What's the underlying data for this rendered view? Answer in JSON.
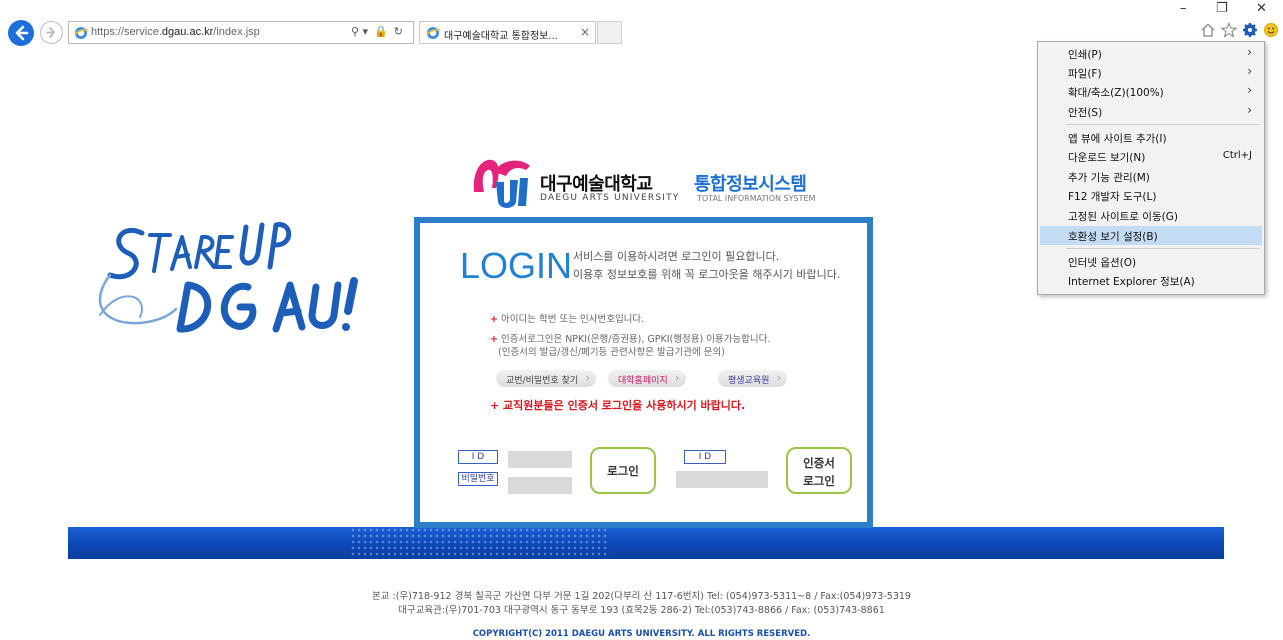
{
  "browser": {
    "url_prefix": "https://service.",
    "url_domain": "dgau.ac.kr",
    "url_path": "/index.jsp",
    "tab_title": "대구예술대학교 통합정보...",
    "tab_close": "×",
    "win_minimize": "–",
    "win_restore": "❐",
    "win_close": "✕",
    "addr_tools": [
      "⚲ ▾",
      "🔒",
      "↻"
    ]
  },
  "header": {
    "univ_kr": "대구예술대학교",
    "system_kr": "통합정보시스템",
    "univ_en": "DAEGU ARTS UNIVERSITY",
    "system_en": "TOTAL INFORMATION SYSTEM"
  },
  "login": {
    "title": "LOGIN",
    "msg1": "서비스를 이용하시려면 로그인이 필요합니다.",
    "msg2": "이용후 정보보호를 위해 꼭 로그아웃을 해주시기 바랍니다.",
    "note_star": "+",
    "note1": "아이디는 학번 또는 인사번호입니다.",
    "note2": "인증서로그인은 NPKI(은행/증권용), GPKI(행정용) 이용가능합니다.",
    "note3": "(인증서의 발급/갱신/폐기등 관련사항은 발급기관에 문의)",
    "link_find": "교번/비밀번호 찾기",
    "link_home": "대학홈페이지",
    "link_lifelong": "평생교육원",
    "faculty_notice": "+ 교직원분들은 인증서 로그인을 사용하시기 바랍니다.",
    "id_label": "I D",
    "pw_label": "비밀번호",
    "login_button": "로그인",
    "cert_id_label": "I D",
    "cert_button_line1": "인증서",
    "cert_button_line2": "로그인",
    "link_colors": {
      "find": "#444444",
      "home": "#c2186b",
      "lifelong": "#3a3aa8"
    }
  },
  "footer": {
    "line1": "본교 :(우)718-912 경북 칠곡군 가산면 다부 거문 1길 202(다부리 산 117-6번지) Tel: (054)973-5311~8 / Fax:(054)973-5319",
    "line2": "대구교육관:(우)701-703 대구광역시 동구 동부로 193 (효목2동 286-2) Tel:(053)743-8866 / Fax: (053)743-8861",
    "copyright": "COPYRIGHT(C) 2011 DAEGU ARTS UNIVERSITY. ALL RIGHTS RESERVED."
  },
  "menu": {
    "items": [
      {
        "label": "인쇄(P)",
        "shortcut": "",
        "arrow": "›"
      },
      {
        "label": "파일(F)",
        "shortcut": "",
        "arrow": "›"
      },
      {
        "label": "확대/축소(Z)(100%)",
        "shortcut": "",
        "arrow": "›"
      },
      {
        "label": "안전(S)",
        "shortcut": "",
        "arrow": "›"
      },
      {
        "label": "앱 뷰에 사이트 추가(I)",
        "shortcut": "",
        "arrow": ""
      },
      {
        "label": "다운로드 보기(N)",
        "shortcut": "Ctrl+J",
        "arrow": ""
      },
      {
        "label": "추가 기능 관리(M)",
        "shortcut": "",
        "arrow": ""
      },
      {
        "label": "F12 개발자 도구(L)",
        "shortcut": "",
        "arrow": ""
      },
      {
        "label": "고정된 사이트로 이동(G)",
        "shortcut": "",
        "arrow": ""
      },
      {
        "label": "호환성 보기 설정(B)",
        "shortcut": "",
        "arrow": ""
      },
      {
        "label": "인터넷 옵션(O)",
        "shortcut": "",
        "arrow": ""
      },
      {
        "label": "Internet Explorer 정보(A)",
        "shortcut": "",
        "arrow": ""
      }
    ],
    "highlighted": "호환성 보기 설정(B)"
  },
  "colors": {
    "accent_blue": "#2d7ec9",
    "login_title": "#1f82d2",
    "notice_red": "#d4181e",
    "menu_highlight": "#c3dcf3",
    "stripe": "#0d48b6"
  }
}
